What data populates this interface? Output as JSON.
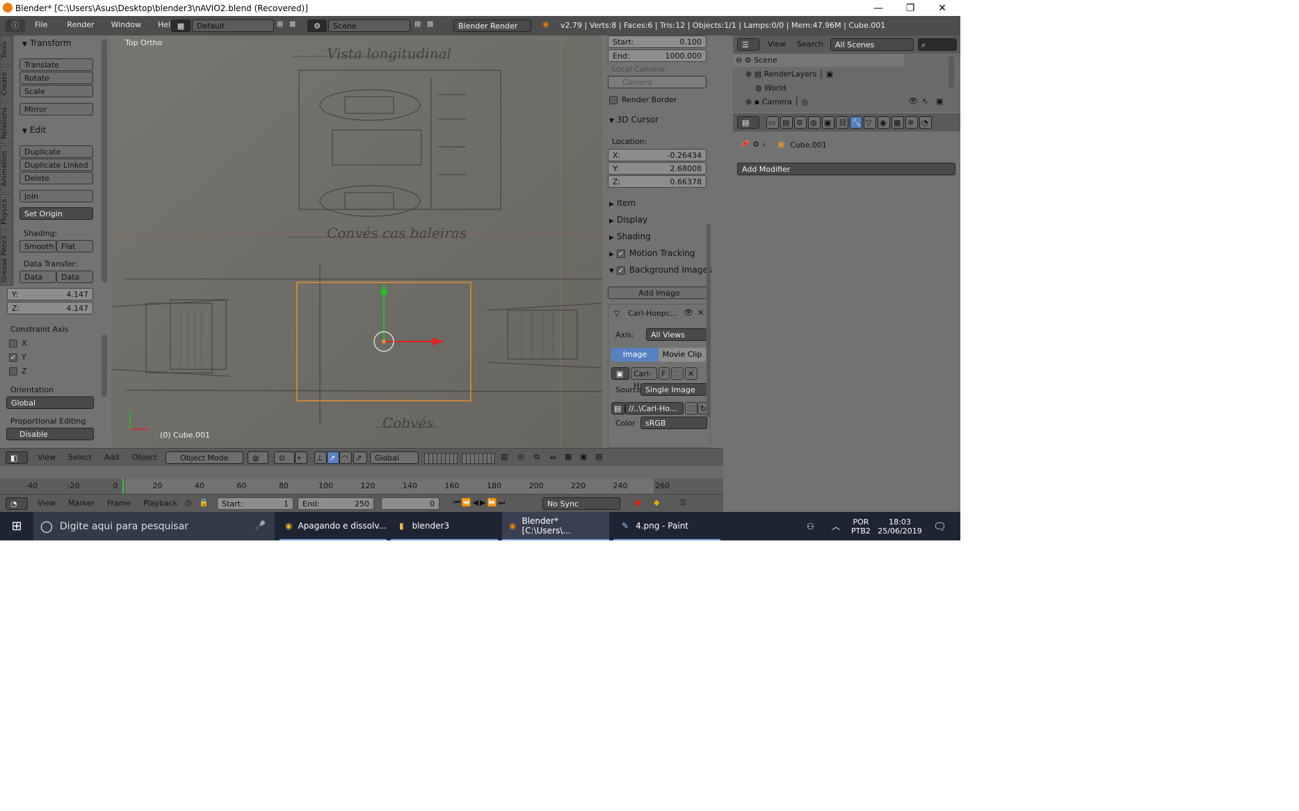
{
  "window": {
    "title": "Blender* [C:\\Users\\Asus\\Desktop\\blender3\\nAVIO2.blend (Recovered)]",
    "minimize": "—",
    "restore": "❐",
    "close": "✕"
  },
  "infobar": {
    "menus": [
      "File",
      "Render",
      "Window",
      "Help"
    ],
    "layout": "Default",
    "scene": "Scene",
    "engine": "Blender Render",
    "stats": "v2.79 | Verts:8 | Faces:6 | Tris:12 | Objects:1/1 | Lamps:0/0 | Mem:47.96M | Cube.001"
  },
  "toolshelf": {
    "tabs": [
      "Tools",
      "Create",
      "Relations",
      "Animation",
      "Physics",
      "Grease Pencil"
    ],
    "transform_header": "Transform",
    "translate": "Translate",
    "rotate": "Rotate",
    "scale": "Scale",
    "mirror": "Mirror",
    "edit_header": "Edit",
    "duplicate": "Duplicate",
    "duplicate_linked": "Duplicate Linked",
    "delete": "Delete",
    "join": "Join",
    "set_origin": "Set Origin",
    "shading_label": "Shading:",
    "smooth": "Smooth",
    "flat": "Flat",
    "data_transfer_label": "Data Transfer:",
    "data": "Data",
    "data_la": "Data La"
  },
  "operator": {
    "y_label": "Y:",
    "y_value": "4.147",
    "z_label": "Z:",
    "z_value": "4.147",
    "constraint_axis": "Constraint Axis",
    "x": "X",
    "y": "Y",
    "z": "Z",
    "orientation_label": "Orientation",
    "orientation": "Global",
    "proportional_label": "Proportional Editing",
    "proportional": "Disable"
  },
  "viewport": {
    "view_name": "Top Ortho",
    "object_label": "(0) Cube.001",
    "blueprint_title_top": "Vista longitudinal",
    "blueprint_title_mid": "Convés cas baleiras",
    "blueprint_title_bottom": "Cobvés"
  },
  "view3d_header": {
    "menus": [
      "View",
      "Select",
      "Add",
      "Object"
    ],
    "mode": "Object Mode",
    "orientation": "Global"
  },
  "npanel": {
    "start_label": "Start:",
    "start": "0.100",
    "end_label": "End:",
    "end": "1000.000",
    "local_camera": "Local Camera:",
    "camera": "Camera",
    "render_border": "Render Border",
    "cursor_header": "3D Cursor",
    "location_label": "Location:",
    "x_label": "X:",
    "x": "-0.26434",
    "y_label": "Y:",
    "y": "2.68008",
    "z_label": "Z:",
    "z": "0.66378",
    "item": "Item",
    "display": "Display",
    "shading": "Shading",
    "motion_tracking": "Motion Tracking",
    "background_images": "Background Images",
    "add_image": "Add Image",
    "bg_name": "Carl-Hoepc...",
    "axis_label": "Axis:",
    "axis": "All Views",
    "image_tab": "Image",
    "movie_clip_tab": "Movie Clip",
    "image_name": "Carl-H",
    "f_label": "F",
    "source_label": "Source",
    "source": "Single Image",
    "path": "//..\\Carl-Ho...",
    "color_label": "Color",
    "color": "sRGB"
  },
  "outliner": {
    "view": "View",
    "search": "Search",
    "filter": "All Scenes",
    "scene": "Scene",
    "renderlayers": "RenderLayers",
    "world": "World",
    "camera": "Camera"
  },
  "properties": {
    "object": "Cube.001",
    "add_modifier": "Add Modifier"
  },
  "timeline": {
    "ticks": [
      "-40",
      "-20",
      "0",
      "20",
      "40",
      "60",
      "80",
      "100",
      "120",
      "140",
      "160",
      "180",
      "200",
      "220",
      "240",
      "260"
    ],
    "menus": [
      "View",
      "Marker",
      "Frame",
      "Playback"
    ],
    "start_label": "Start:",
    "start": "1",
    "end_label": "End:",
    "end": "250",
    "current": "0",
    "sync": "No Sync"
  },
  "taskbar": {
    "search": "Digite aqui para pesquisar",
    "apps": [
      "Apagando e dissolv...",
      "blender3",
      "Blender* [C:\\Users\\...",
      "4.png - Paint"
    ],
    "lang1": "POR",
    "lang2": "PTB2",
    "time": "18:03",
    "date": "25/06/2019"
  }
}
